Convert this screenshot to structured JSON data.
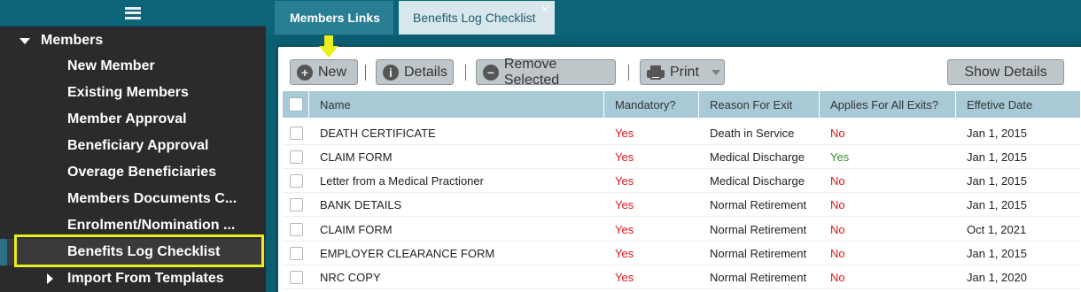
{
  "sidebar": {
    "group_label": "Members",
    "items": [
      {
        "label": "New Member"
      },
      {
        "label": "Existing Members"
      },
      {
        "label": "Member Approval"
      },
      {
        "label": "Beneficiary Approval"
      },
      {
        "label": "Overage Beneficiaries"
      },
      {
        "label": "Members Documents C..."
      },
      {
        "label": "Enrolment/Nomination ..."
      },
      {
        "label": "Benefits Log Checklist"
      },
      {
        "label": "Import From Templates"
      }
    ],
    "active_item": "Benefits Log Checklist"
  },
  "tabs": [
    {
      "label": "Members Links"
    },
    {
      "label": "Benefits Log Checklist"
    }
  ],
  "toolbar": {
    "new_label": "New",
    "details_label": "Details",
    "remove_label": "Remove Selected",
    "print_label": "Print",
    "show_details_label": "Show Details"
  },
  "table": {
    "columns": [
      "Name",
      "Mandatory?",
      "Reason For Exit",
      "Applies For All Exits?",
      "Effetive Date"
    ],
    "rows": [
      {
        "name": "DEATH CERTIFICATE",
        "mandatory": "Yes",
        "reason": "Death in Service",
        "applies": "No",
        "date": "Jan 1, 2015"
      },
      {
        "name": "CLAIM FORM",
        "mandatory": "Yes",
        "reason": "Medical Discharge",
        "applies": "Yes",
        "date": "Jan 1, 2015"
      },
      {
        "name": "Letter from a Medical Practioner",
        "mandatory": "Yes",
        "reason": "Medical Discharge",
        "applies": "No",
        "date": "Jan 1, 2015"
      },
      {
        "name": "BANK DETAILS",
        "mandatory": "Yes",
        "reason": "Normal Retirement",
        "applies": "No",
        "date": "Jan 1, 2015"
      },
      {
        "name": "CLAIM FORM",
        "mandatory": "Yes",
        "reason": "Normal Retirement",
        "applies": "No",
        "date": "Oct 1, 2021"
      },
      {
        "name": "EMPLOYER CLEARANCE FORM",
        "mandatory": "Yes",
        "reason": "Normal Retirement",
        "applies": "No",
        "date": "Jan 1, 2015"
      },
      {
        "name": "NRC COPY",
        "mandatory": "Yes",
        "reason": "Normal Retirement",
        "applies": "No",
        "date": "Jan 1, 2020"
      }
    ]
  },
  "colors": {
    "sidebar_bg": "#2b2b2d",
    "header_teal": "#0c6478",
    "table_header": "#a8cad6",
    "highlight": "#e8ef1a",
    "yes_red": "#e0141a",
    "yes_green": "#3a8a2c"
  }
}
